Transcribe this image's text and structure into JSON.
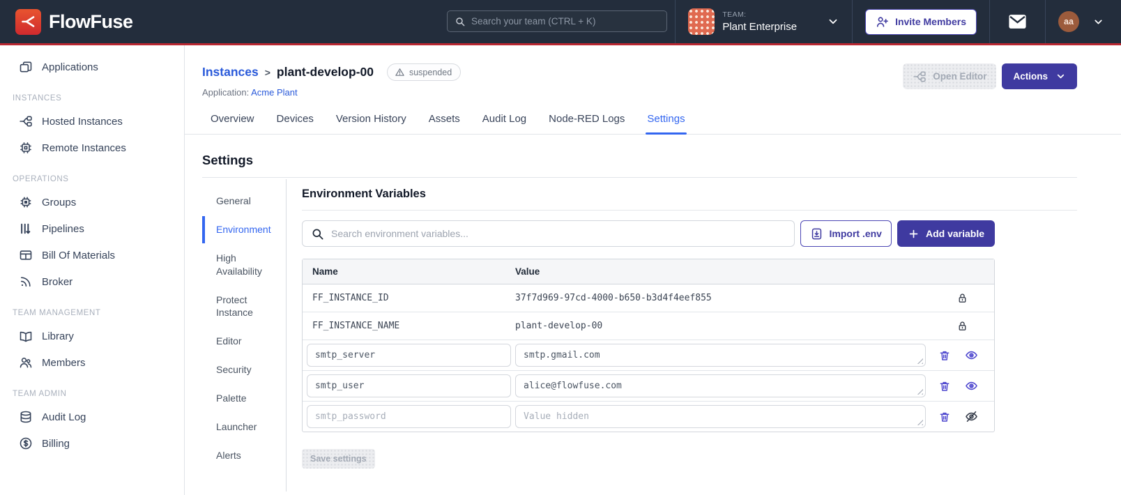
{
  "colors": {
    "header_bg": "#232D3C",
    "brand_red": "#DD3A2A",
    "accent_red_line": "#BA2832",
    "indigo_button": "#3F3AA0",
    "link_blue": "#2A5ADA",
    "active_blue": "#3366F0",
    "team_avatar_orange": "#E06A50",
    "user_avatar_brown": "#9C5B3C"
  },
  "header": {
    "brand": "FlowFuse",
    "search_placeholder": "Search your team (CTRL + K)",
    "team_label": "TEAM:",
    "team_name": "Plant Enterprise",
    "invite_button": "Invite Members",
    "avatar_initials": "aa"
  },
  "sidebar": {
    "top_items": [
      {
        "label": "Applications"
      }
    ],
    "groups": [
      {
        "title": "INSTANCES",
        "items": [
          "Hosted Instances",
          "Remote Instances"
        ]
      },
      {
        "title": "OPERATIONS",
        "items": [
          "Groups",
          "Pipelines",
          "Bill Of Materials",
          "Broker"
        ]
      },
      {
        "title": "TEAM MANAGEMENT",
        "items": [
          "Library",
          "Members"
        ]
      },
      {
        "title": "TEAM ADMIN",
        "items": [
          "Audit Log",
          "Billing"
        ]
      }
    ]
  },
  "page": {
    "breadcrumb_root": "Instances",
    "breadcrumb_separator": ">",
    "instance_name": "plant-develop-00",
    "status_badge": "suspended",
    "application_label": "Application:",
    "application_name": "Acme Plant",
    "open_editor_button": "Open Editor",
    "actions_button": "Actions"
  },
  "tabs": [
    "Overview",
    "Devices",
    "Version History",
    "Assets",
    "Audit Log",
    "Node-RED Logs",
    "Settings"
  ],
  "active_tab": "Settings",
  "settings": {
    "title": "Settings",
    "nav": [
      "General",
      "Environment",
      "High Availability",
      "Protect Instance",
      "Editor",
      "Security",
      "Palette",
      "Launcher",
      "Alerts"
    ],
    "active_nav": "Environment"
  },
  "environment": {
    "title": "Environment Variables",
    "search_placeholder": "Search environment variables...",
    "import_button": "Import .env",
    "add_button": "Add variable",
    "columns": [
      "Name",
      "Value"
    ],
    "locked_rows": [
      {
        "name": "FF_INSTANCE_ID",
        "value": "37f7d969-97cd-4000-b650-b3d4f4eef855"
      },
      {
        "name": "FF_INSTANCE_NAME",
        "value": "plant-develop-00"
      }
    ],
    "editable_rows": [
      {
        "name": "smtp_server",
        "value": "smtp.gmail.com"
      },
      {
        "name": "smtp_user",
        "value": "alice@flowfuse.com"
      },
      {
        "name": "smtp_password",
        "value": "",
        "value_placeholder": "Value hidden"
      }
    ],
    "save_button": "Save settings"
  }
}
